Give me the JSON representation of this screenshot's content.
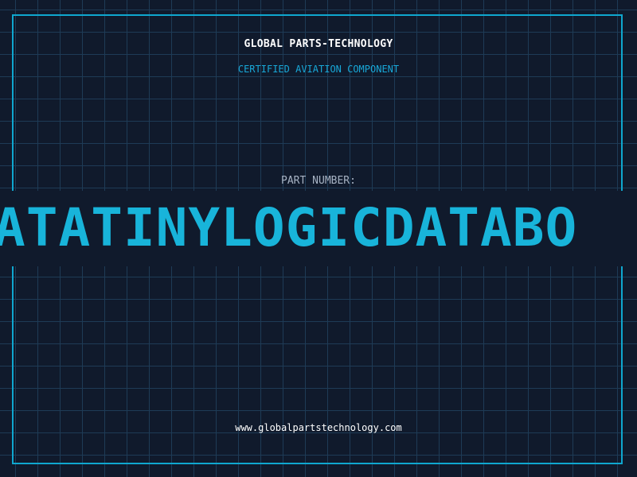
{
  "header": {
    "brand": "GLOBAL PARTS-TECHNOLOGY",
    "subtitle": "CERTIFIED AVIATION COMPONENT"
  },
  "part": {
    "label": "PART NUMBER:",
    "number": "ATATINYLOGICDATABO"
  },
  "footer": {
    "url": "www.globalpartstechnology.com"
  },
  "colors": {
    "background": "#101a2c",
    "grid": "#1e3b56",
    "accent": "#18b4da",
    "frame": "#0fa7cf"
  }
}
